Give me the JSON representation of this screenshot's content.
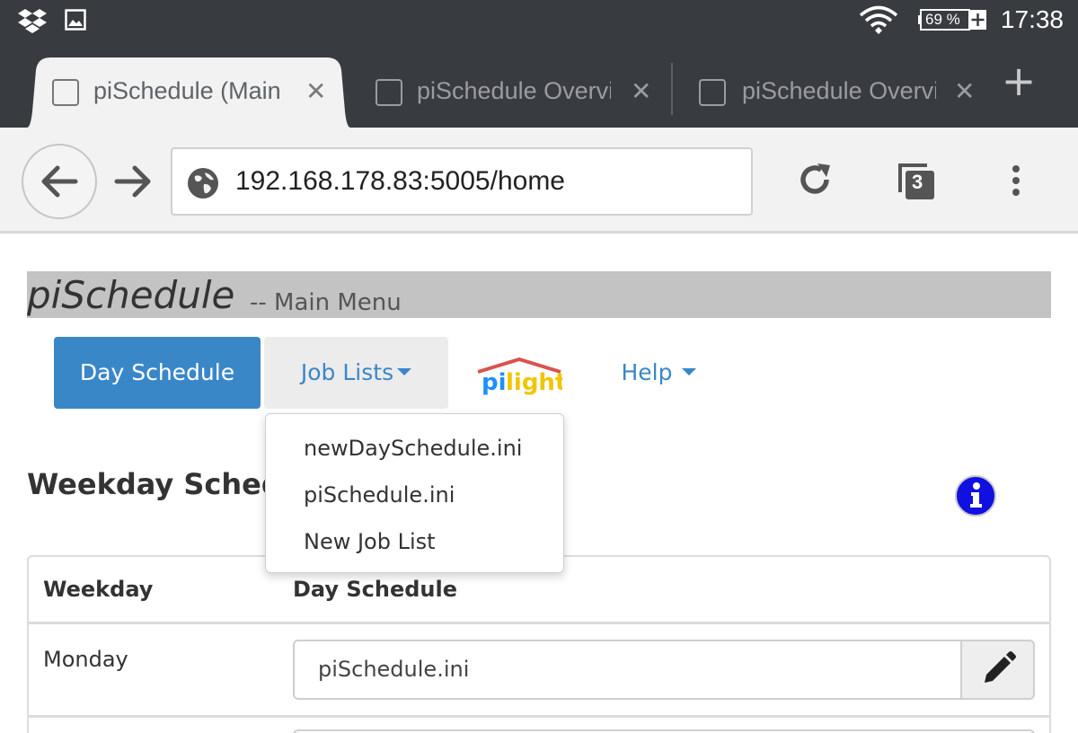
{
  "status_bar": {
    "left_icons": [
      "dropbox-icon",
      "image-icon"
    ],
    "wifi_icon": "wifi-icon",
    "battery_percent": 69,
    "battery_label": "69 %",
    "time": "17:38"
  },
  "tabs": [
    {
      "title": "piSchedule (Main Menu)",
      "active": true
    },
    {
      "title": "piSchedule Overview",
      "active": false
    },
    {
      "title": "piSchedule Overview",
      "active": false
    }
  ],
  "tab_close_glyph": "✕",
  "new_tab_glyph": "+",
  "toolbar": {
    "url": "192.168.178.83:5005/home",
    "tab_count": "3"
  },
  "page": {
    "app_name": "piSchedule",
    "subtitle": "-- Main Menu",
    "nav": {
      "day_schedule": "Day Schedule",
      "job_lists": "Job Lists",
      "pilight_logo": "pilight",
      "help": "Help"
    },
    "job_lists_menu": [
      "newDaySchedule.ini",
      "piSchedule.ini",
      "New Job List"
    ],
    "section_title": "Weekday Schedule",
    "table": {
      "headers": [
        "Weekday",
        "Day Schedule"
      ],
      "rows": [
        {
          "weekday": "Monday",
          "schedule": "piSchedule.ini"
        }
      ]
    }
  },
  "colors": {
    "accent": "#3a87c8",
    "title_bar": "#c3c3c3",
    "browser_chrome": "#383b40",
    "info_icon": "#1010e0"
  }
}
